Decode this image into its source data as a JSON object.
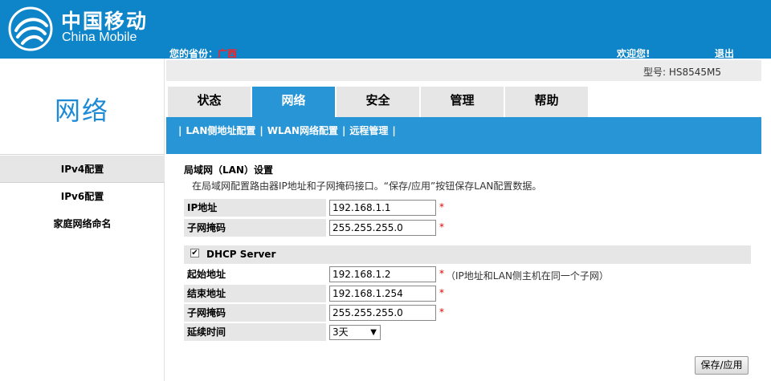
{
  "header": {
    "brand_cn": "中国移动",
    "brand_en": "China Mobile",
    "province_label": "您的省份：",
    "province_value": "广西",
    "welcome": "欢迎您!",
    "logout": "退出",
    "bg_color": "#0e85c9"
  },
  "model": {
    "text": "型号: HS8545M5"
  },
  "left": {
    "title": "网络",
    "items": [
      {
        "label": "IPv4配置"
      },
      {
        "label": "IPv6配置"
      },
      {
        "label": "家庭网络命名"
      }
    ]
  },
  "tabs": [
    {
      "label": "状态"
    },
    {
      "label": "网络"
    },
    {
      "label": "安全"
    },
    {
      "label": "管理"
    },
    {
      "label": "帮助"
    }
  ],
  "subnav": {
    "items": [
      {
        "label": "LAN侧地址配置"
      },
      {
        "label": "WLAN网络配置"
      },
      {
        "label": "远程管理"
      }
    ],
    "accent_color": "#2895d6"
  },
  "lan": {
    "title": "局域网（LAN）设置",
    "desc": "在局域网配置路由器IP地址和子网掩码接口。“保存/应用”按钮保存LAN配置数据。",
    "ip_label": "IP地址",
    "ip_value": "192.168.1.1",
    "mask_label": "子网掩码",
    "mask_value": "255.255.255.0"
  },
  "dhcp": {
    "label": "DHCP Server",
    "checked": true,
    "start_label": "起始地址",
    "start_value": "192.168.1.2",
    "start_hint": "（IP地址和LAN侧主机在同一个子网）",
    "end_label": "结束地址",
    "end_value": "192.168.1.254",
    "mask_label": "子网掩码",
    "mask_value": "255.255.255.0",
    "lease_label": "延续时间",
    "lease_value": "3天"
  },
  "required_mark": "*",
  "save_label": "保存/应用"
}
